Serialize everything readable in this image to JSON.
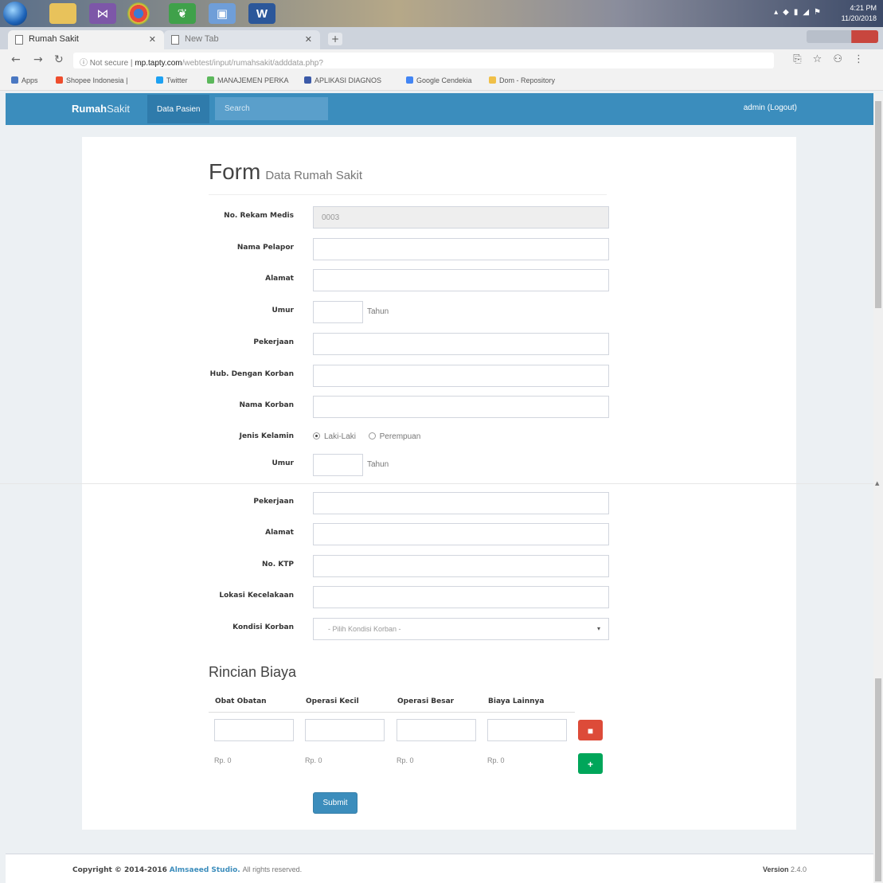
{
  "taskbar": {
    "time": "4:21 PM",
    "date": "11/20/2018",
    "apps": [
      "windows-start",
      "file-explorer",
      "visual-studio",
      "chrome",
      "leaf-app",
      "photo-viewer",
      "word"
    ]
  },
  "browser": {
    "tabs": [
      {
        "label": "Rumah Sakit",
        "active": true
      },
      {
        "label": "New Tab",
        "active": false
      }
    ],
    "security_label": "Not secure",
    "url_host": "mp.tapty.com",
    "url_path": "/webtest/input/rumahsakit/adddata.php?",
    "bookmarks": [
      "Apps",
      "Shopee Indonesia |",
      "Twitter",
      "MANAJEMEN PERKA",
      "APLIKASI DIAGNOS",
      "Google Cendekia",
      "Dom - Repository"
    ]
  },
  "navbar": {
    "brand_bold": "Rumah",
    "brand_light": "Sakit",
    "nav_link": "Data Pasien",
    "search_placeholder": "Search",
    "user": "admin (Logout)",
    "color": "#3b8dbd"
  },
  "form": {
    "title": "Form",
    "subtitle": "Data Rumah Sakit",
    "fields": {
      "rekam_medis": {
        "label": "No. Rekam Medis",
        "value": "0003"
      },
      "nama_pelapor": {
        "label": "Nama Pelapor"
      },
      "alamat_pelapor": {
        "label": "Alamat"
      },
      "umur_pelapor": {
        "label": "Umur",
        "suffix": "Tahun"
      },
      "pekerjaan_pelapor": {
        "label": "Pekerjaan"
      },
      "hubungan": {
        "label": "Hub. Dengan Korban"
      },
      "nama_korban": {
        "label": "Nama Korban"
      },
      "jenis_kelamin": {
        "label": "Jenis Kelamin",
        "options": [
          "Laki-Laki",
          "Perempuan"
        ],
        "selected": "Laki-Laki"
      },
      "umur_korban": {
        "label": "Umur",
        "suffix": "Tahun"
      },
      "pekerjaan_korban": {
        "label": "Pekerjaan"
      },
      "alamat_korban": {
        "label": "Alamat"
      },
      "ktp": {
        "label": "No. KTP"
      },
      "lokasi": {
        "label": "Lokasi Kecelakaan"
      },
      "kondisi": {
        "label": "Kondisi Korban",
        "selected": "- Pilih Kondisi Korban -"
      }
    },
    "biaya": {
      "title": "Rincian Biaya",
      "headers": [
        "Obat Obatan",
        "Operasi Kecil",
        "Operasi Besar",
        "Biaya Lainnya"
      ],
      "totals": [
        "Rp. 0",
        "Rp. 0",
        "Rp. 0",
        "Rp. 0"
      ]
    },
    "submit_label": "Submit"
  },
  "footer": {
    "copyright_prefix": "Copyright © 2014-2016",
    "company": "Almsaeed Studio.",
    "rights": "All rights reserved.",
    "version_label": "Version",
    "version": "2.4.0"
  },
  "colors": {
    "primary": "#3c8dbc",
    "danger": "#dd4b39",
    "success": "#00a65a",
    "background": "#ecf0f3"
  }
}
